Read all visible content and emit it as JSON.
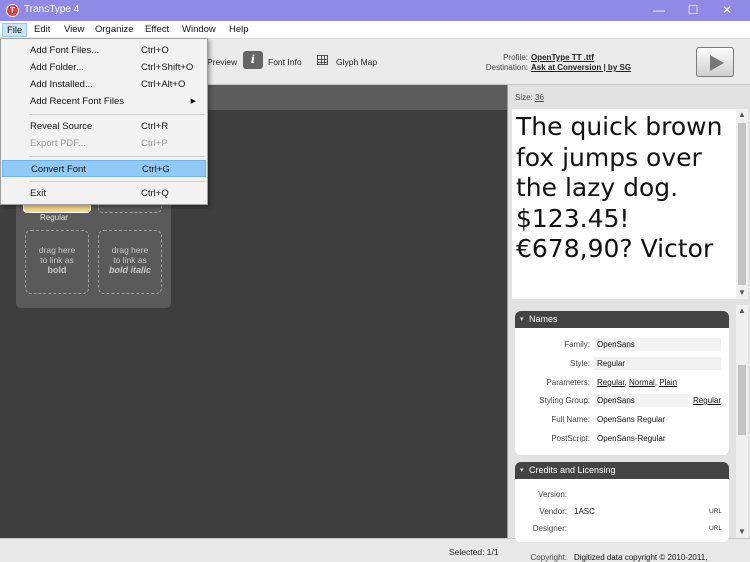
{
  "window": {
    "title": "TransType 4",
    "app_icon": "transtype-app-icon",
    "controls": {
      "minimize": "—",
      "maximize": "☐",
      "close": "✕"
    }
  },
  "menubar": {
    "items": [
      {
        "label": "File",
        "active": true
      },
      {
        "label": "Edit"
      },
      {
        "label": "View"
      },
      {
        "label": "Organize"
      },
      {
        "label": "Effect"
      },
      {
        "label": "Window"
      },
      {
        "label": "Help"
      }
    ]
  },
  "file_menu": {
    "items": [
      {
        "label": "Add Font Files...",
        "shortcut": "Ctrl+O"
      },
      {
        "label": "Add Folder...",
        "shortcut": "Ctrl+Shift+O"
      },
      {
        "label": "Add Installed...",
        "shortcut": "Ctrl+Alt+O"
      },
      {
        "label": "Add Recent Font Files",
        "shortcut": "",
        "submenu_arrow": "▶"
      },
      {
        "label": "Reveal Source",
        "shortcut": "Ctrl+R"
      },
      {
        "label": "Export PDF...",
        "shortcut": "Ctrl+P",
        "disabled": true
      },
      {
        "label": "Convert Font",
        "shortcut": "Ctrl+G",
        "highlighted": true
      },
      {
        "label": "Exit",
        "shortcut": "Ctrl+Q"
      }
    ]
  },
  "toolbar": {
    "preview_label": "Preview",
    "font_info_label": "Font Info",
    "font_info_icon": "i",
    "glyph_map_label": "Glyph Map",
    "profile_label": "Profile:",
    "profile_value": "OpenType TT .ttf",
    "destination_label": "Destination:",
    "destination_value": "Ask at Conversion | by SG"
  },
  "canvas": {
    "regular_label": "Regular",
    "slot_bold": {
      "line1": "drag here",
      "line2": "to link as",
      "line3": "bold"
    },
    "slot_bold_italic": {
      "line1": "drag here",
      "line2": "to link as",
      "line3": "bold italic"
    }
  },
  "statusbar": {
    "selected": "Selected: 1/1"
  },
  "right_panel": {
    "size_label": "Size:",
    "size_value": "36",
    "preview_text": "The quick brown fox jumps over the lazy dog. $123.45! €678,90? Victor",
    "names": {
      "title": "Names",
      "family_label": "Family:",
      "family": "OpenSans",
      "style_label": "Style:",
      "style": "Regular",
      "parameters_label": "Parameters:",
      "param1": "Regular",
      "param2": "Normal",
      "param3": "Plain",
      "styling_group_label": "Styling Group:",
      "styling_group": "OpenSans",
      "styling_group_extra": "Regular",
      "full_name_label": "Full Name:",
      "full_name": "OpenSans Regular",
      "postscript_label": "PostScript:",
      "postscript": "OpenSans-Regular"
    },
    "credits": {
      "title": "Credits and Licensing",
      "version_label": "Version:",
      "version": "",
      "vendor_label": "Vendor:",
      "vendor": "1ASC",
      "designer_label": "Designer:",
      "designer": "",
      "url_tag": "URL",
      "copyright_label": "Copyright:",
      "copyright": "Digitized data copyright © 2010-2011,"
    }
  }
}
